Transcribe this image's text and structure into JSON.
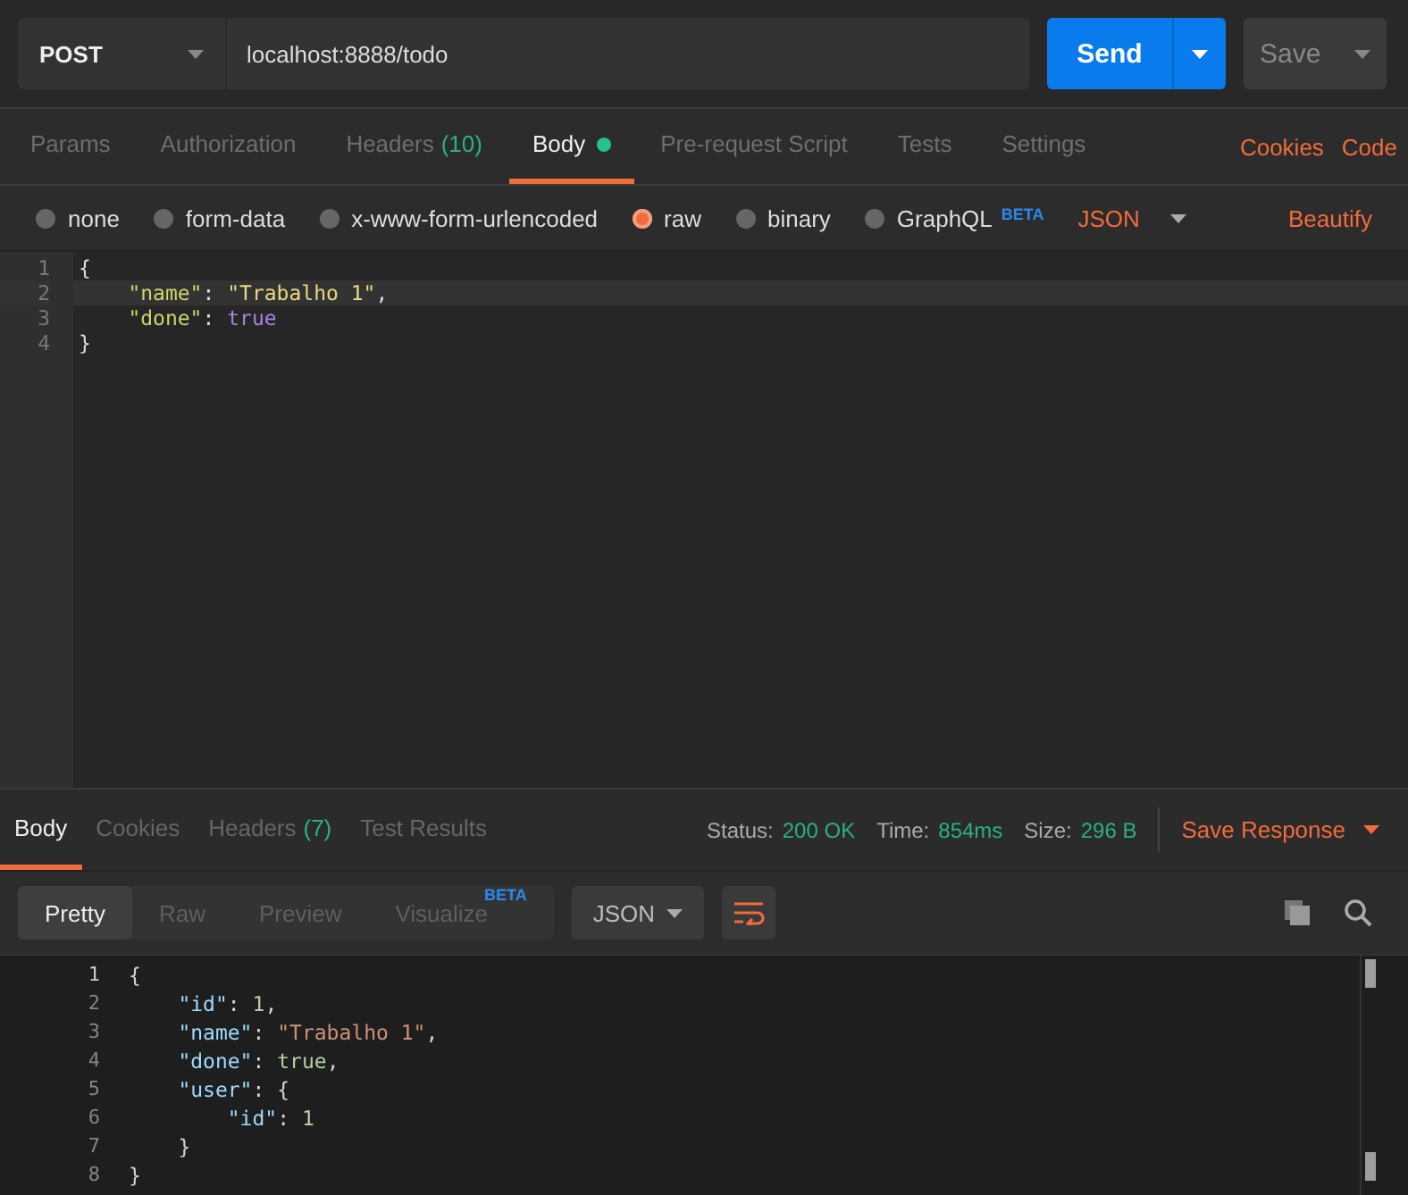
{
  "request": {
    "method": "POST",
    "url": "localhost:8888/todo",
    "send": "Send",
    "save": "Save"
  },
  "tabs": [
    {
      "label": "Params",
      "selected": false,
      "dot": false
    },
    {
      "label": "Authorization",
      "selected": false,
      "dot": false
    },
    {
      "label": "Headers",
      "count": "(10)",
      "selected": false,
      "dot": false
    },
    {
      "label": "Body",
      "selected": true,
      "dot": true
    },
    {
      "label": "Pre-request Script",
      "selected": false,
      "dot": false
    },
    {
      "label": "Tests",
      "selected": false,
      "dot": false
    },
    {
      "label": "Settings",
      "selected": false,
      "dot": false
    }
  ],
  "links": [
    "Cookies",
    "Code"
  ],
  "body_types": [
    {
      "label": "none",
      "selected": false
    },
    {
      "label": "form-data",
      "selected": false
    },
    {
      "label": "x-www-form-urlencoded",
      "selected": false
    },
    {
      "label": "raw",
      "selected": true
    },
    {
      "label": "binary",
      "selected": false
    },
    {
      "label": "GraphQL",
      "badge": "BETA",
      "selected": false
    }
  ],
  "body_format": "JSON",
  "beautify": "Beautify",
  "request_editor": [
    {
      "number": "1",
      "active": false,
      "tokens": [
        {
          "kind": "punct",
          "text": "{"
        }
      ]
    },
    {
      "number": "2",
      "active": true,
      "tokens": [
        {
          "kind": "key",
          "text": "    \"name\""
        },
        {
          "kind": "punct",
          "text": ": "
        },
        {
          "kind": "str",
          "text": "\"Trabalho 1\""
        },
        {
          "kind": "punct",
          "text": ","
        }
      ]
    },
    {
      "number": "3",
      "active": false,
      "tokens": [
        {
          "kind": "key",
          "text": "    \"done\""
        },
        {
          "kind": "punct",
          "text": ": "
        },
        {
          "kind": "bool",
          "text": "true"
        }
      ]
    },
    {
      "number": "4",
      "active": false,
      "tokens": [
        {
          "kind": "punct",
          "text": "}"
        }
      ]
    }
  ],
  "response": {
    "tabs": [
      {
        "label": "Body",
        "selected": true
      },
      {
        "label": "Cookies",
        "selected": false
      },
      {
        "label": "Headers",
        "count": "(7)",
        "selected": false
      },
      {
        "label": "Test Results",
        "selected": false
      }
    ],
    "stats": [
      {
        "label": "Status:",
        "value": "200 OK"
      },
      {
        "label": "Time:",
        "value": "854ms"
      },
      {
        "label": "Size:",
        "value": "296 B"
      }
    ],
    "save_response": "Save Response",
    "view_modes": [
      {
        "label": "Pretty",
        "selected": true
      },
      {
        "label": "Raw",
        "selected": false
      },
      {
        "label": "Preview",
        "selected": false
      },
      {
        "label": "Visualize",
        "badge": "BETA",
        "selected": false
      }
    ],
    "format": "JSON",
    "wrap_lines": true
  },
  "response_editor": [
    {
      "number": "1",
      "tokens": [
        {
          "kind": "punct",
          "text": "{"
        }
      ]
    },
    {
      "number": "2",
      "tokens": [
        {
          "kind": "key",
          "text": "    \"id\""
        },
        {
          "kind": "punct",
          "text": ": "
        },
        {
          "kind": "num",
          "text": "1"
        },
        {
          "kind": "punct",
          "text": ","
        }
      ]
    },
    {
      "number": "3",
      "tokens": [
        {
          "kind": "key",
          "text": "    \"name\""
        },
        {
          "kind": "punct",
          "text": ": "
        },
        {
          "kind": "str",
          "text": "\"Trabalho 1\""
        },
        {
          "kind": "punct",
          "text": ","
        }
      ]
    },
    {
      "number": "4",
      "tokens": [
        {
          "kind": "key",
          "text": "    \"done\""
        },
        {
          "kind": "punct",
          "text": ": "
        },
        {
          "kind": "bool",
          "text": "true"
        },
        {
          "kind": "punct",
          "text": ","
        }
      ]
    },
    {
      "number": "5",
      "tokens": [
        {
          "kind": "key",
          "text": "    \"user\""
        },
        {
          "kind": "punct",
          "text": ": {"
        }
      ]
    },
    {
      "number": "6",
      "tokens": [
        {
          "kind": "key",
          "text": "        \"id\""
        },
        {
          "kind": "punct",
          "text": ": "
        },
        {
          "kind": "num",
          "text": "1"
        }
      ]
    },
    {
      "number": "7",
      "tokens": [
        {
          "kind": "punct",
          "text": "    }"
        }
      ]
    },
    {
      "number": "8",
      "tokens": [
        {
          "kind": "punct",
          "text": "}"
        }
      ]
    }
  ]
}
